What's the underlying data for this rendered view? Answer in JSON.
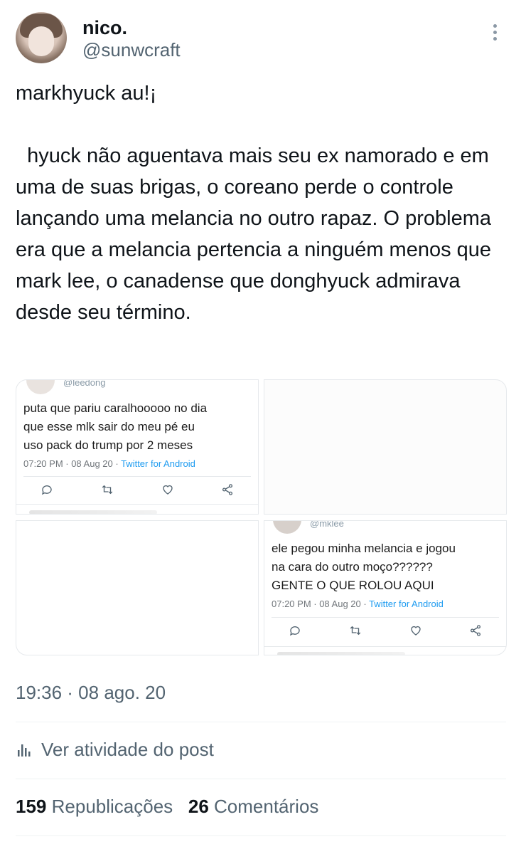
{
  "author": {
    "display_name": "nico.",
    "handle": "@sunwcraft"
  },
  "tweet": {
    "text": "markhyuck au!¡\n\n  hyuck não aguentava mais seu ex namorado e em uma de suas brigas, o coreano perde o controle lançando uma melancia no outro rapaz. O problema era que a melancia pertencia a ninguém menos que mark lee, o canadense que donghyuck admirava desde seu término."
  },
  "media": {
    "image1": {
      "handle": "@leedong",
      "text": "puta que pariu caralhooooo no dia\nque esse mlk sair do meu pé eu\nuso pack do trump por 2 meses",
      "meta_time": "07:20 PM · 08 Aug 20 · ",
      "meta_source": "Twitter for Android"
    },
    "image4": {
      "handle": "@mklee",
      "text": "ele pegou minha melancia e jogou\nna cara do outro moço??????\nGENTE O QUE ROLOU AQUI",
      "meta_time": "07:20 PM · 08 Aug 20 · ",
      "meta_source": "Twitter for Android"
    }
  },
  "footer": {
    "timestamp": "19:36 · 08 ago. 20",
    "activity_label": "Ver atividade do post",
    "reposts_count": "159",
    "reposts_label": "Republicações",
    "comments_count": "26",
    "comments_label": "Comentários"
  },
  "colors": {
    "primary_text": "#0f1419",
    "secondary_text": "#536471",
    "link": "#1d9bf0",
    "divider": "#eff3f4"
  },
  "icons": [
    "more-vertical-icon",
    "reply-icon",
    "retweet-icon",
    "like-icon",
    "share-icon",
    "analytics-icon"
  ]
}
